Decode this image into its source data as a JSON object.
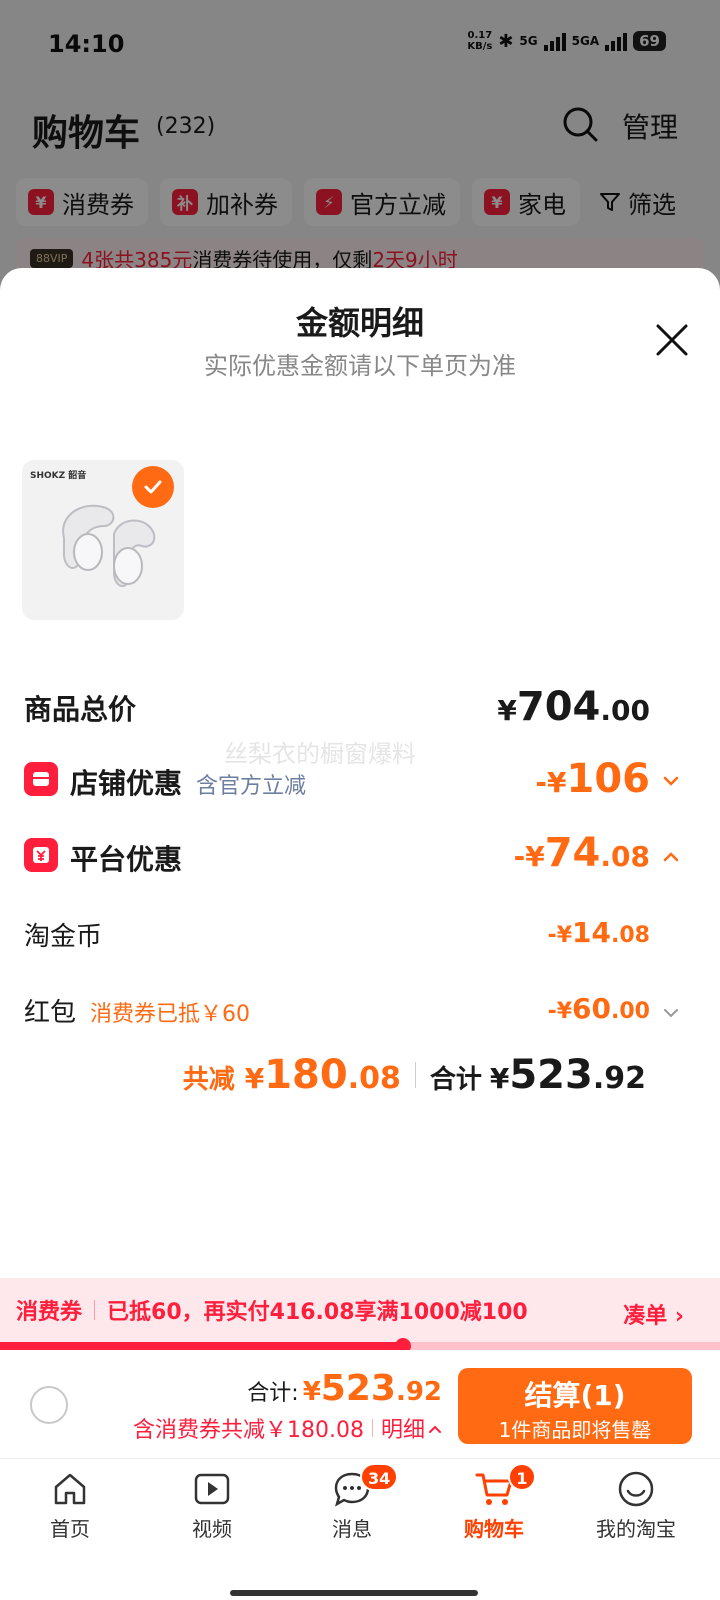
{
  "status_bar": {
    "time": "14:10",
    "net_speed_value": "0.17",
    "net_speed_unit": "KB/s",
    "sig1": "5G",
    "sig2": "5GA",
    "battery": "69"
  },
  "cart_header": {
    "title": "购物车",
    "count": "(232)",
    "manage": "管理"
  },
  "chips": [
    {
      "icon": "¥",
      "label": "消费券"
    },
    {
      "icon": "补",
      "label": "加补券"
    },
    {
      "icon": "⚡",
      "label": "官方立减"
    },
    {
      "icon": "¥",
      "label": "家电"
    }
  ],
  "filter_label": "筛选",
  "notice": {
    "vip": "88VIP",
    "highlight": "4张共385元",
    "text": "消费券待使用，仅剩",
    "time_left": "2天9小时"
  },
  "sheet": {
    "title": "金额明细",
    "subtitle": "实际优惠金额请以下单页为准",
    "product_brand": "SHOKZ 韶音",
    "watermark": "丝梨衣的橱窗爆料",
    "rows": {
      "total": {
        "label": "商品总价",
        "cur": "¥",
        "int": "704",
        "dec": ".00"
      },
      "shop": {
        "label": "店铺优惠",
        "sub": "含官方立减",
        "cur": "-¥",
        "int": "106",
        "dec": ""
      },
      "platform": {
        "label": "平台优惠",
        "cur": "-¥",
        "int": "74",
        "dec": ".08"
      },
      "coins": {
        "label": "淘金币",
        "cur": "-¥",
        "int": "14",
        "dec": ".08"
      },
      "redpacket": {
        "label": "红包",
        "sub": "消费券已抵￥60",
        "cur": "-¥",
        "int": "60",
        "dec": ".00"
      }
    },
    "summary": {
      "reduce_label": "共减",
      "reduce_cur": "¥",
      "reduce_int": "180",
      "reduce_dec": ".08",
      "total_label": "合计",
      "total_cur": "¥",
      "total_int": "523",
      "total_dec": ".92"
    }
  },
  "coupon_bar": {
    "tag": "消费券",
    "text": "已抵60，再实付416.08享满1000减100",
    "link": "凑单 ›",
    "progress": 0.56
  },
  "checkout": {
    "total_label": "合计:",
    "cur": "¥",
    "int": "523",
    "dec": ".92",
    "detail_text": "含消费券共减￥180.08",
    "detail_link": "明细",
    "button_main": "结算(1)",
    "button_sub": "1件商品即将售罄"
  },
  "tabs": [
    {
      "label": "首页",
      "icon": "home-icon"
    },
    {
      "label": "视频",
      "icon": "video-icon"
    },
    {
      "label": "消息",
      "icon": "message-icon",
      "badge": "34"
    },
    {
      "label": "购物车",
      "icon": "cart-icon",
      "badge": "1",
      "active": true
    },
    {
      "label": "我的淘宝",
      "icon": "profile-icon"
    }
  ],
  "colors": {
    "accent_orange": "#ff6a12",
    "accent_red": "#ff1f3d"
  }
}
